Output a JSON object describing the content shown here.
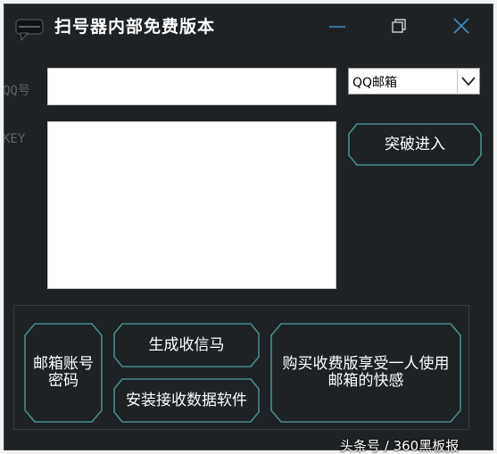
{
  "window": {
    "title": "扫号器内部免费版本"
  },
  "form": {
    "qq_label": "QQ号",
    "key_label": "KEY",
    "qq_value": "",
    "key_value": "",
    "mail_select": {
      "selected": "QQ邮箱"
    }
  },
  "buttons": {
    "break_in": "突破进入",
    "mail_account": "邮箱账号密码",
    "generate_signal": "生成收信马",
    "install_software": "安装接收数据软件",
    "buy_paid": "购买收费版享受一人使用邮箱的快感"
  },
  "watermark": "头条号 / 360黑板报",
  "colors": {
    "background": "#1e2225",
    "button_border": "#4a8d8e",
    "text": "#ffffff",
    "window_icon": "#3f8fc0"
  },
  "icons": {
    "app": "speech-bubble-icon",
    "minimize": "minimize-icon",
    "maximize": "restore-icon",
    "close": "close-icon",
    "dropdown": "chevron-down-icon"
  }
}
